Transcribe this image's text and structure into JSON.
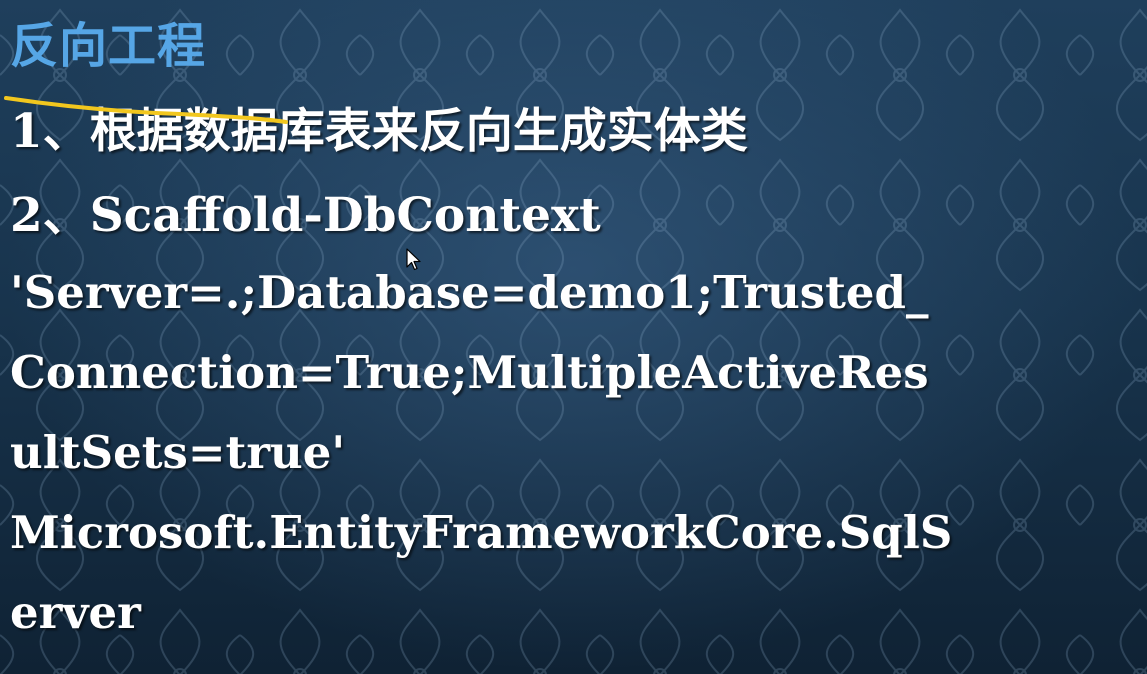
{
  "slide": {
    "title": "反向工程",
    "lines": [
      "1、根据数据库表来反向生成实体类",
      "2、Scaffold-DbContext",
      "'Server=.;Database=demo1;Trusted_",
      "Connection=True;MultipleActiveRes",
      "ultSets=true'",
      "Microsoft.EntityFrameworkCore.SqlS",
      "erver"
    ]
  },
  "colors": {
    "title": "#56a6e6",
    "text": "#ffffff",
    "background": "#1a3650",
    "annotation_stroke": "#f2c71e"
  },
  "icons": {
    "cursor": "mouse-pointer-icon"
  }
}
